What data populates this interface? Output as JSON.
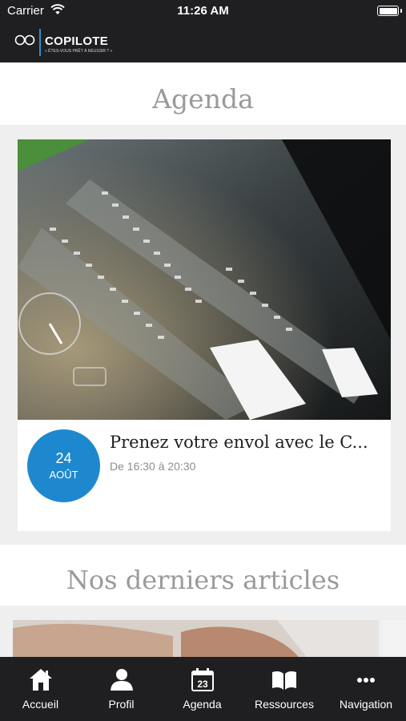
{
  "status_bar": {
    "carrier": "Carrier",
    "time": "11:26 AM"
  },
  "header": {
    "logo_name": "COPILOTE",
    "logo_tagline": "« ÊTES-VOUS PRÊT À RÉUSSIR ? »"
  },
  "agenda": {
    "heading": "Agenda",
    "event": {
      "day": "24",
      "month": "AOÛT",
      "title": "Prenez votre envol avec le C...",
      "time": "De 16:30 à 20:30"
    }
  },
  "articles": {
    "heading": "Nos derniers articles"
  },
  "tabbar": {
    "items": [
      {
        "label": "Accueil",
        "icon": "home-icon"
      },
      {
        "label": "Profil",
        "icon": "person-icon"
      },
      {
        "label": "Agenda",
        "icon": "calendar-icon",
        "calendar_day": "23"
      },
      {
        "label": "Ressources",
        "icon": "book-icon"
      },
      {
        "label": "Navigation",
        "icon": "more-icon"
      }
    ]
  },
  "colors": {
    "header_bg": "#1f1f21",
    "accent": "#1e88cf",
    "section_title": "#9a9a9a"
  }
}
